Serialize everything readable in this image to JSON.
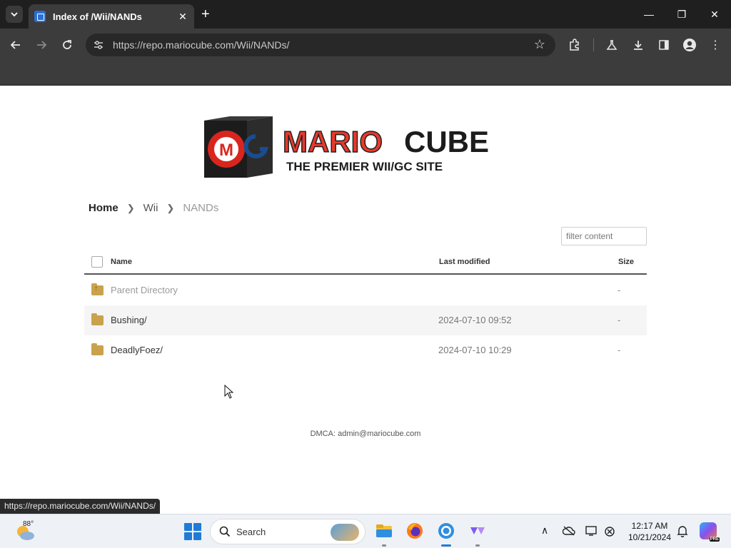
{
  "browser": {
    "tab_title": "Index of /Wii/NANDs",
    "url": "https://repo.mariocube.com/Wii/NANDs/",
    "status_url": "https://repo.mariocube.com/Wii/NANDs/"
  },
  "logo": {
    "brand_left": "MARIO",
    "brand_right": "CUBE",
    "tagline": "THE PREMIER WII/GC SITE",
    "cube_letter": "M"
  },
  "breadcrumb": {
    "home": "Home",
    "level1": "Wii",
    "current": "NANDs"
  },
  "filter": {
    "placeholder": "filter content"
  },
  "table": {
    "headers": {
      "name": "Name",
      "modified": "Last modified",
      "size": "Size"
    },
    "rows": [
      {
        "name": "Parent Directory",
        "modified": "",
        "size": "-"
      },
      {
        "name": "Bushing/",
        "modified": "2024-07-10 09:52",
        "size": "-"
      },
      {
        "name": "DeadlyFoez/",
        "modified": "2024-07-10 10:29",
        "size": "-"
      }
    ]
  },
  "footer": {
    "dmca": "DMCA: admin@mariocube.com"
  },
  "taskbar": {
    "temperature": "88°",
    "search_label": "Search",
    "time": "12:17 AM",
    "date": "10/21/2024"
  },
  "colors": {
    "folder": "#c9a24c",
    "accent": "#1f7bd6",
    "browser_dark": "#3c3c3c"
  }
}
